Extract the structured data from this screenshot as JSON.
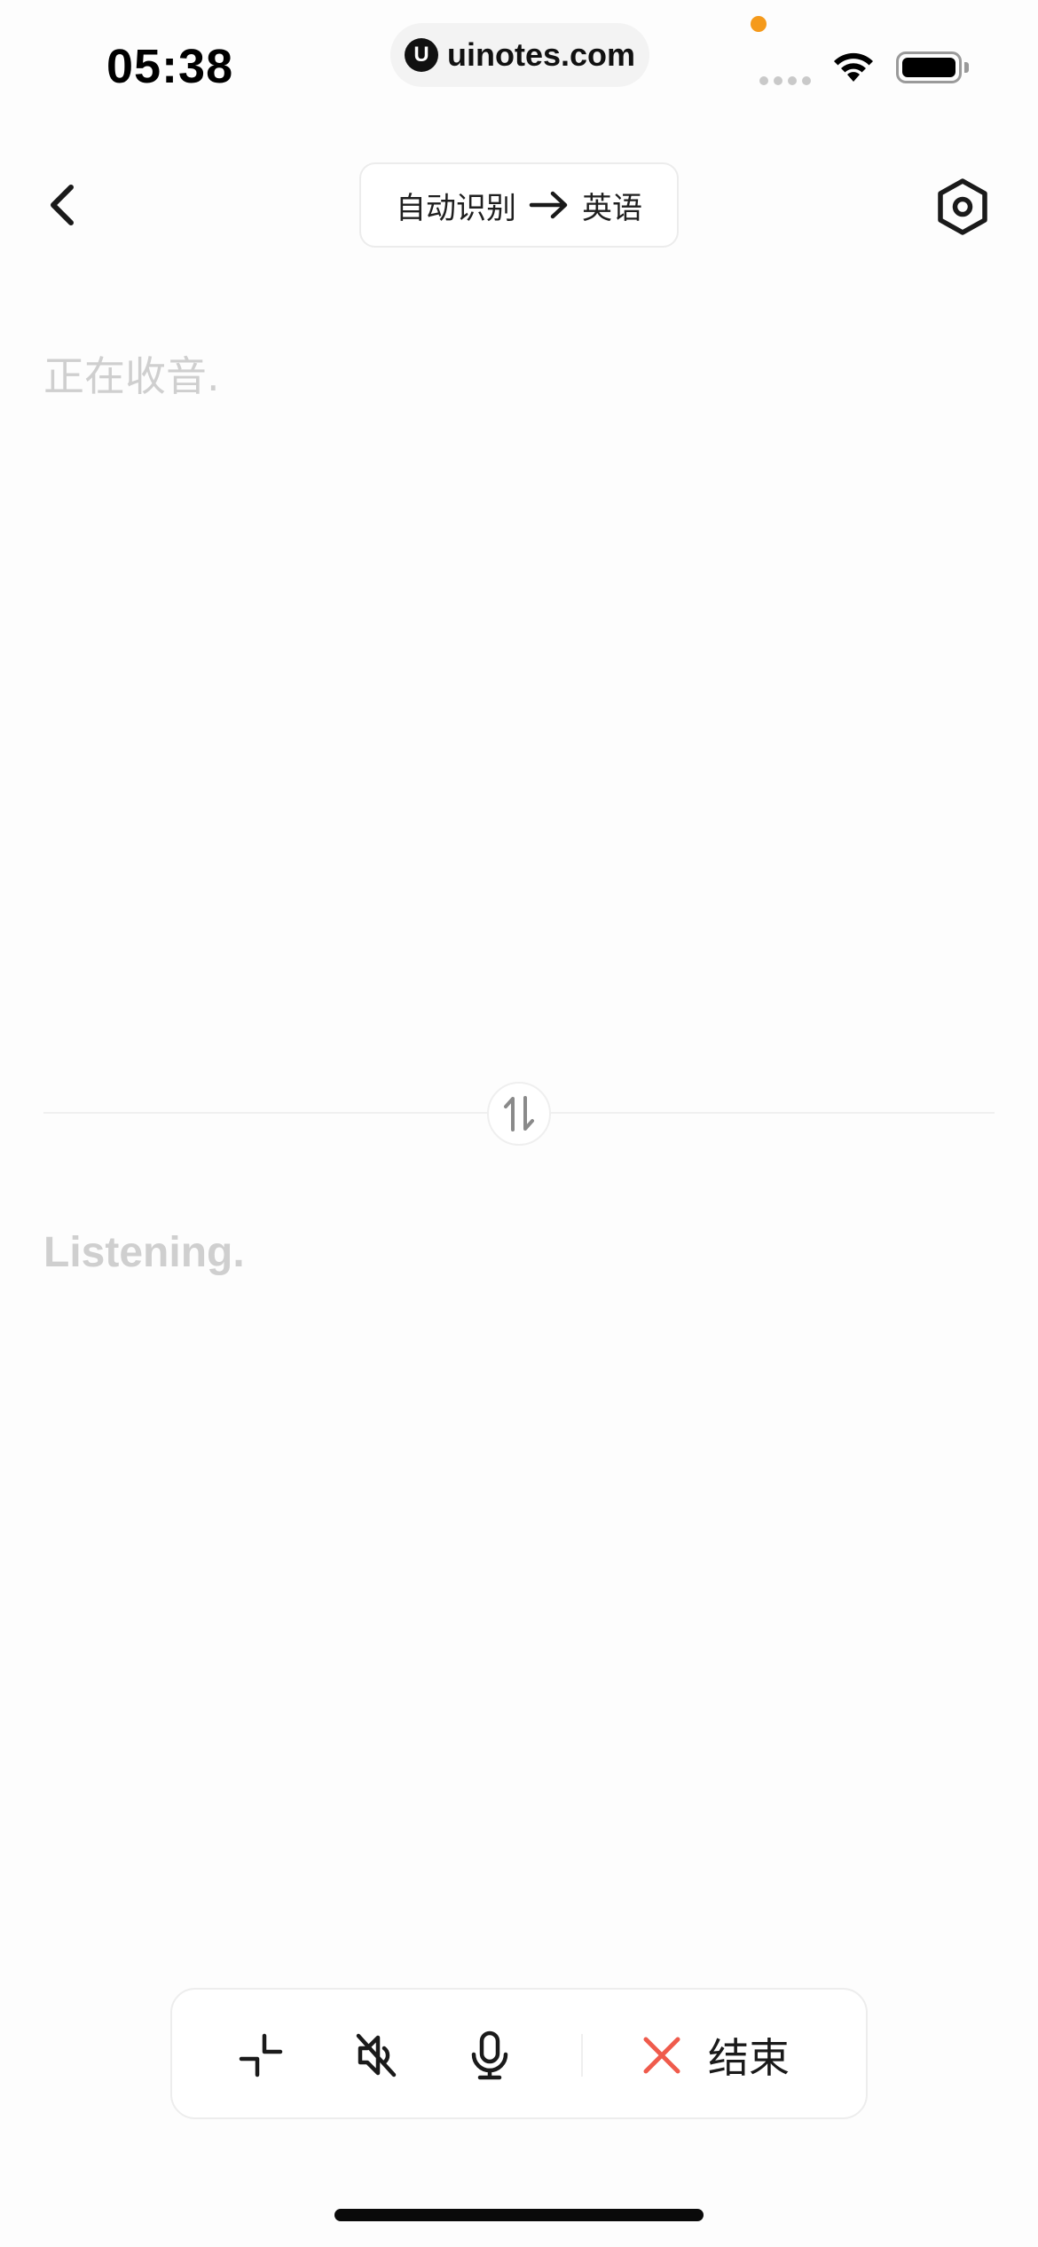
{
  "status_bar": {
    "time": "05:38",
    "url": "uinotes.com",
    "url_logo_letter": "U",
    "mic_indicator_color": "#f59a1b"
  },
  "nav": {
    "back_icon": "chevron-left-icon",
    "source_language": "自动识别",
    "arrow_icon": "arrow-right-icon",
    "target_language": "英语",
    "settings_icon": "hexagon-settings-icon"
  },
  "source_panel": {
    "placeholder": "正在收音."
  },
  "swap_icon": "swap-vertical-icon",
  "target_panel": {
    "placeholder": "Listening."
  },
  "toolbar": {
    "shrink_icon": "collapse-icon",
    "mute_icon": "speaker-muted-icon",
    "mic_icon": "microphone-icon",
    "end_icon": "close-icon",
    "end_label": "结束",
    "end_icon_color": "#ef5b4c"
  }
}
